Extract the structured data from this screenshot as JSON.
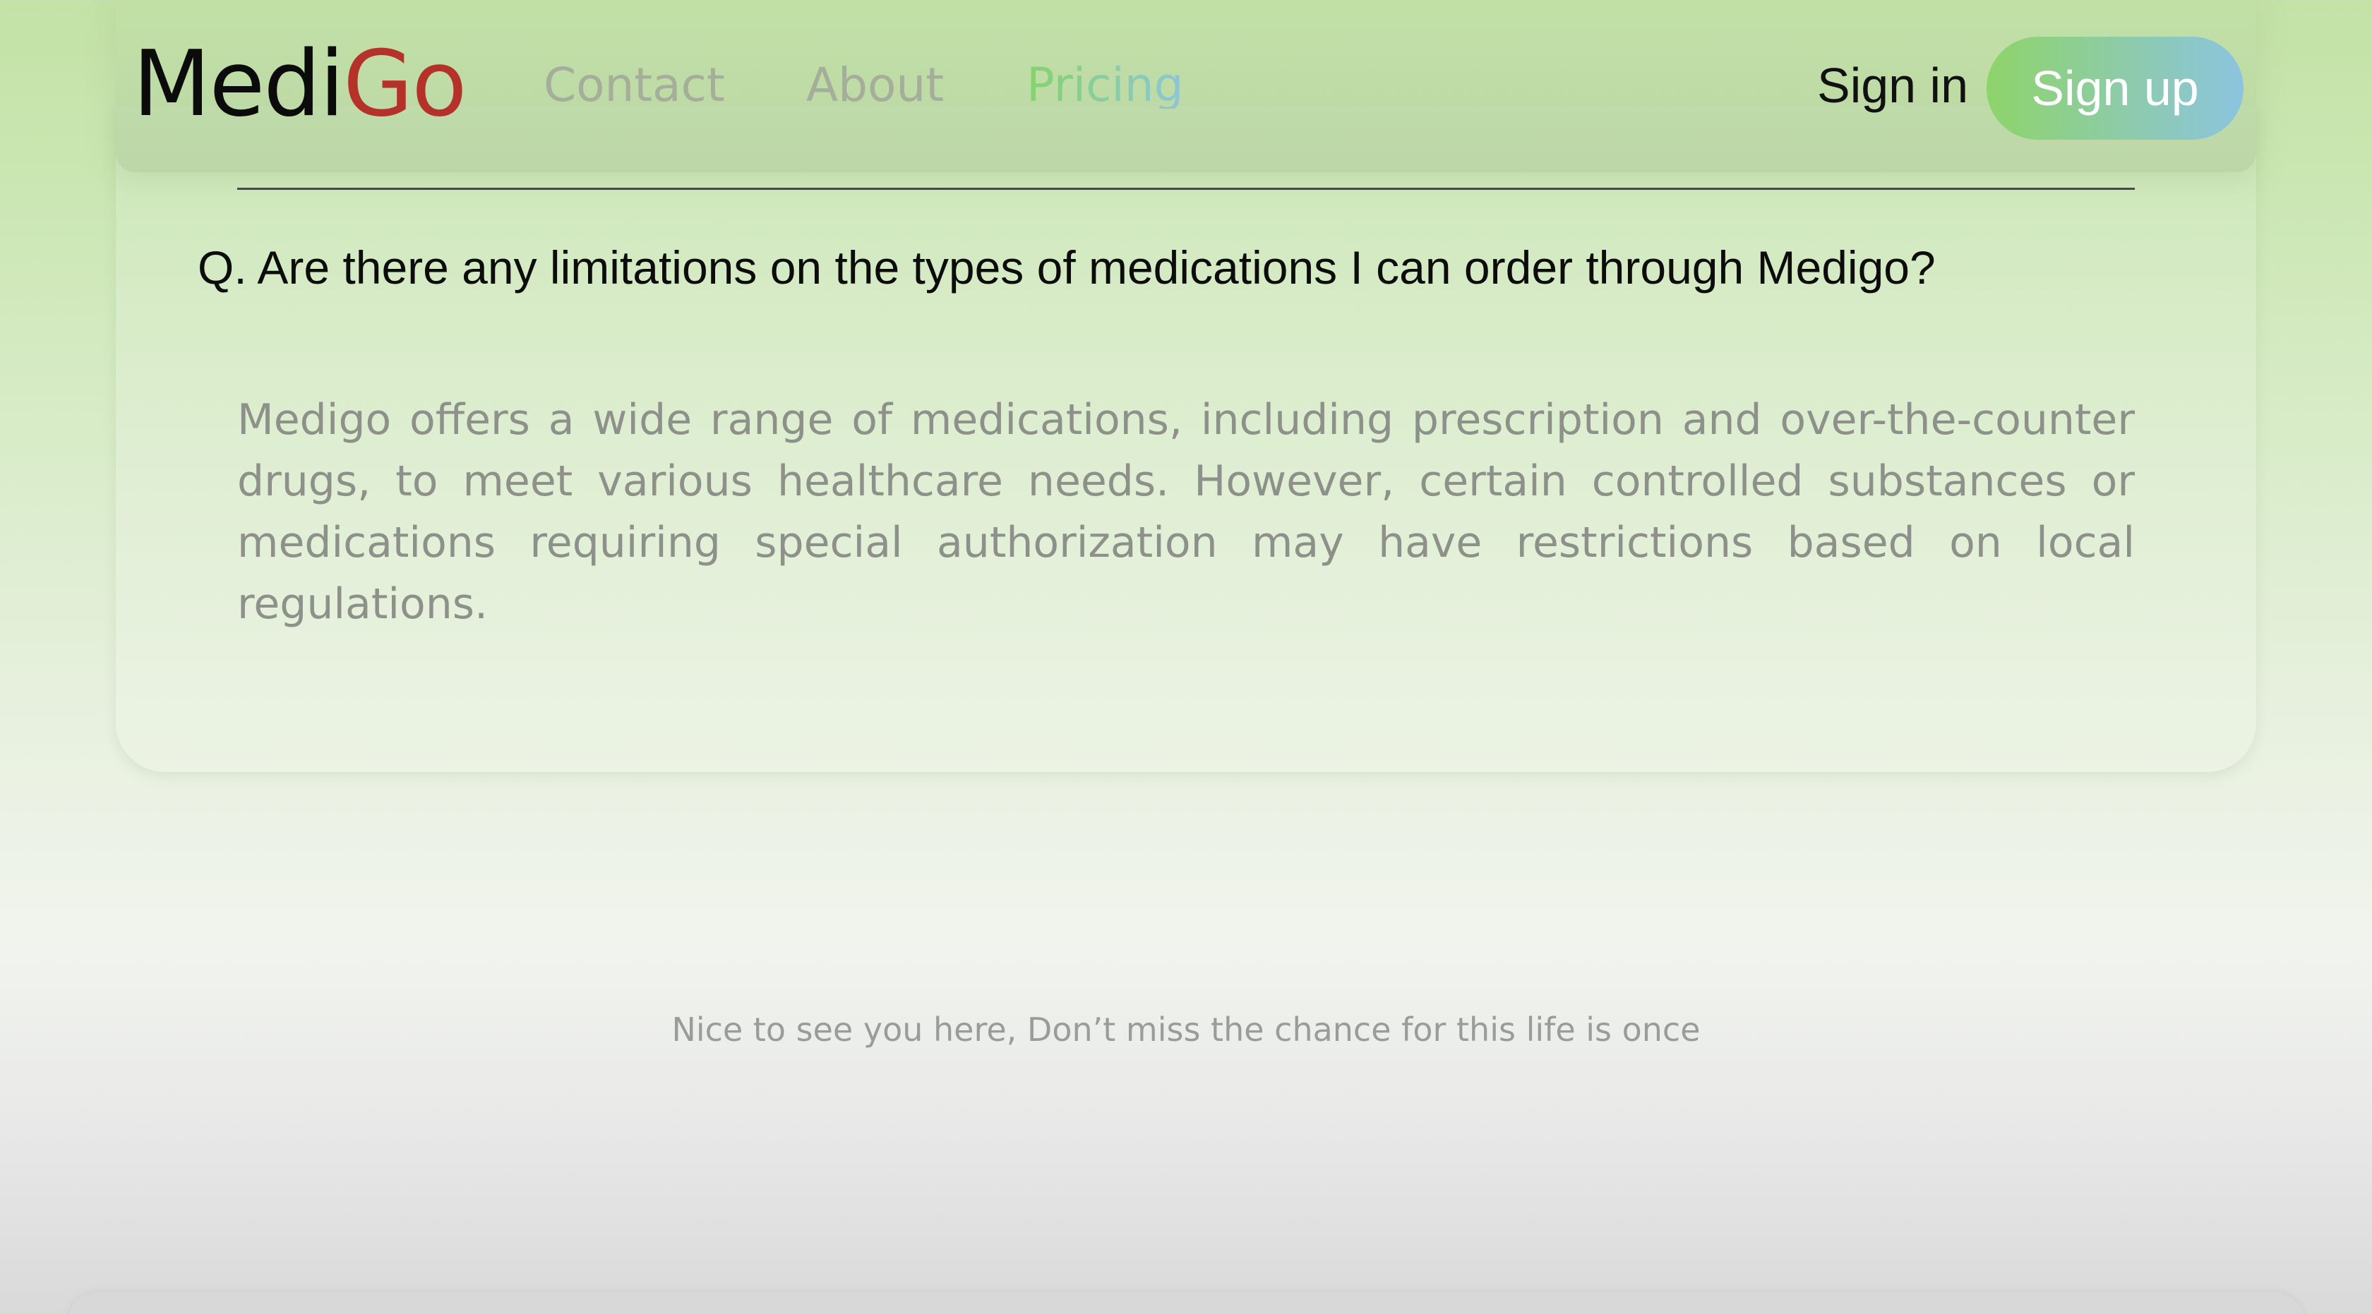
{
  "header": {
    "logo": {
      "part1": "Medi",
      "part2": "Go"
    },
    "nav": {
      "contact": "Contact",
      "about": "About",
      "pricing": "Pricing"
    },
    "sign_in": "Sign in",
    "sign_up": "Sign up"
  },
  "faq": {
    "question": "Q. Are there any limitations on the types of medications I can order through Medigo?",
    "answer": "Medigo offers a wide range of medications, including prescription and over-the-counter drugs, to meet various healthcare needs. However, certain controlled substances or medications requiring special authorization may have restrictions based on local regulations."
  },
  "footer": {
    "tagline": "Nice to see you here, Don’t miss the chance for this life is once"
  },
  "colors": {
    "logo_accent": "#b5322a",
    "brand_gradient_start": "#8ed46a",
    "brand_gradient_end": "#8cc4e0"
  }
}
